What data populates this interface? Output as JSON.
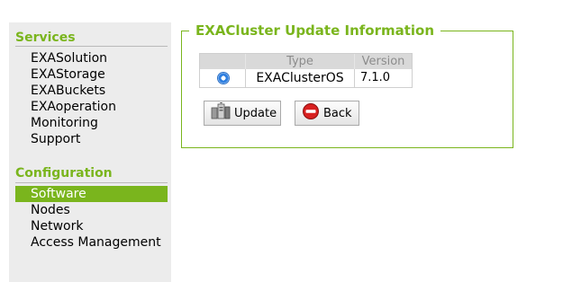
{
  "sidebar": {
    "services": {
      "title": "Services",
      "items": [
        "EXASolution",
        "EXAStorage",
        "EXABuckets",
        "EXAoperation",
        "Monitoring",
        "Support"
      ]
    },
    "configuration": {
      "title": "Configuration",
      "items": [
        "Software",
        "Nodes",
        "Network",
        "Access Management"
      ],
      "active": "Software"
    }
  },
  "panel": {
    "legend": "EXACluster Update Information",
    "table": {
      "headers": [
        "",
        "Type",
        "Version"
      ],
      "rows": [
        {
          "selected": true,
          "type": "EXAClusterOS",
          "version": "7.1.0"
        }
      ]
    },
    "buttons": {
      "update": "Update",
      "back": "Back"
    }
  },
  "colors": {
    "accent": "#7ab51d",
    "sidebar_bg": "#ececec",
    "radio": "#2f7fe0",
    "back_icon": "#d82020"
  },
  "icons": {
    "update": "server-update-icon",
    "back": "no-entry-icon"
  }
}
